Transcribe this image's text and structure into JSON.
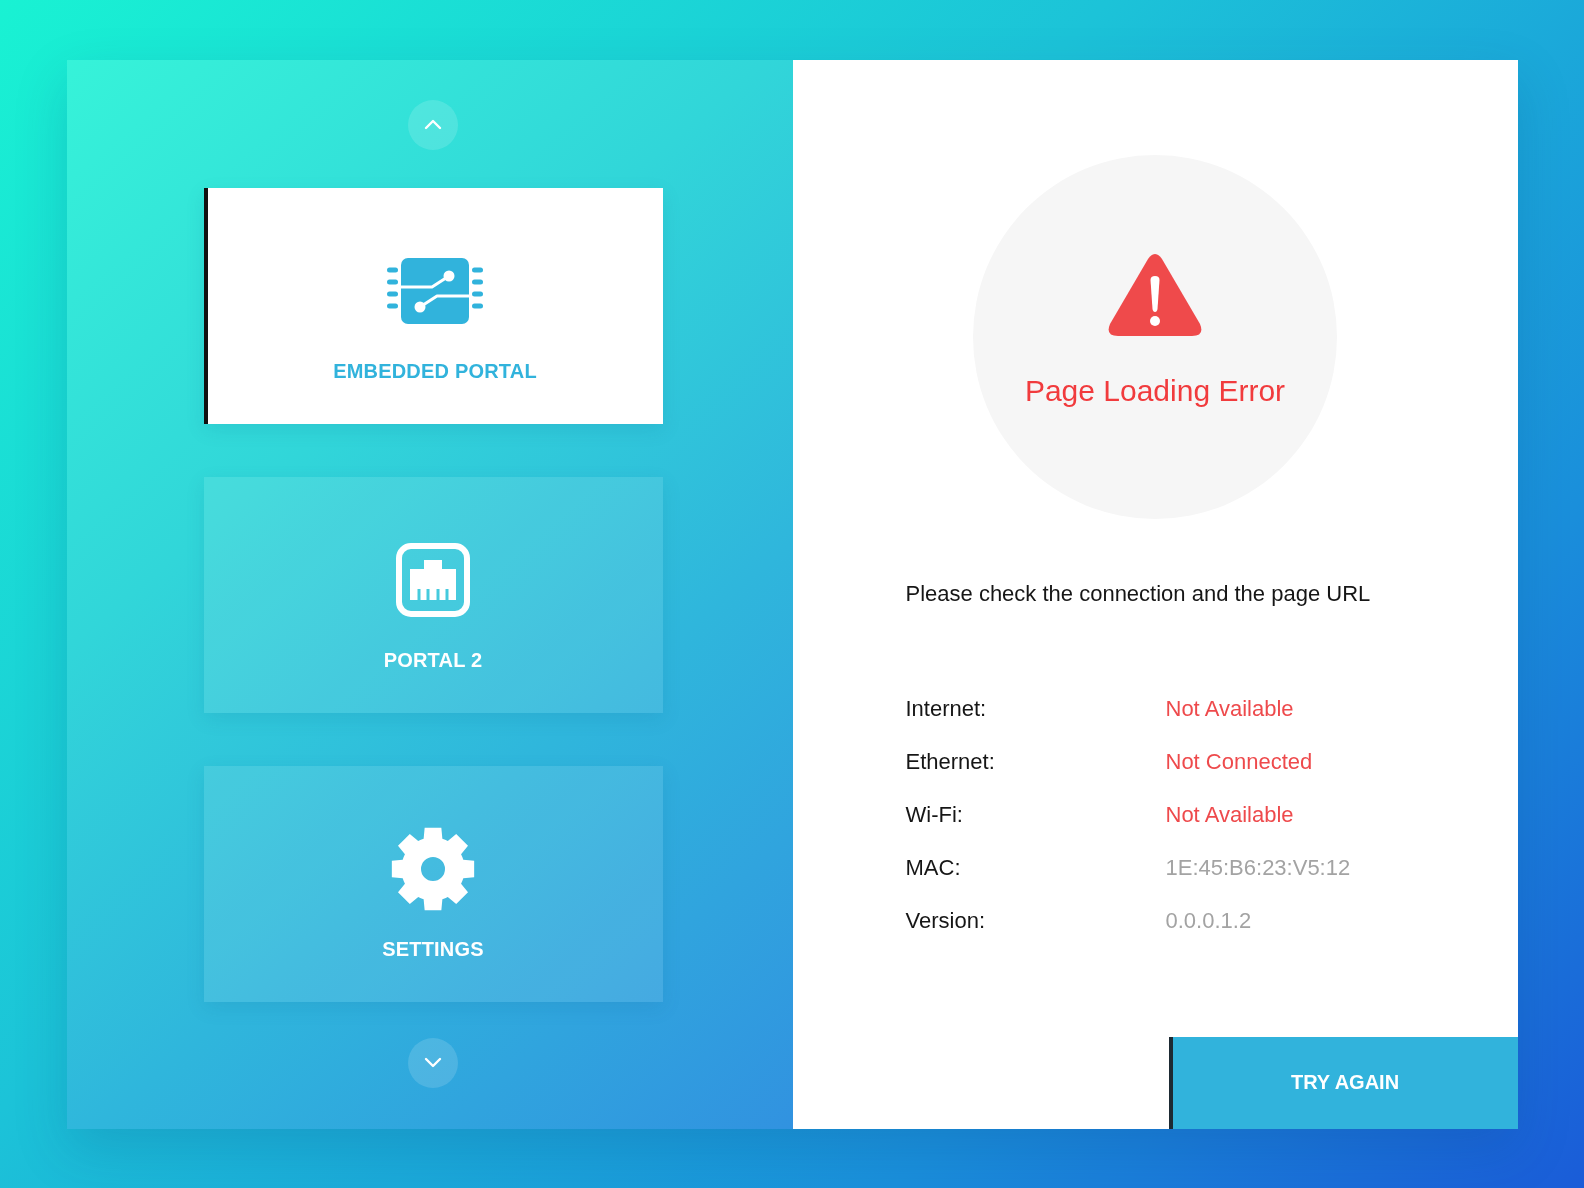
{
  "sidebar": {
    "items": [
      {
        "label": "EMBEDDED PORTAL",
        "kind": "chip",
        "selected": true
      },
      {
        "label": "PORTAL 2",
        "kind": "ethernet",
        "selected": false
      },
      {
        "label": "SETTINGS",
        "kind": "gear",
        "selected": false
      }
    ]
  },
  "error": {
    "title": "Page Loading Error",
    "message": "Please check the connection and the page URL"
  },
  "status": [
    {
      "label": "Internet:",
      "value": "Not Available",
      "alert": true
    },
    {
      "label": "Ethernet:",
      "value": "Not Connected",
      "alert": true
    },
    {
      "label": "Wi-Fi:",
      "value": "Not Available",
      "alert": true
    },
    {
      "label": "MAC:",
      "value": "1E:45:B6:23:V5:12",
      "alert": false
    },
    {
      "label": "Version:",
      "value": "0.0.0.1.2",
      "alert": false
    }
  ],
  "action": {
    "label": "TRY AGAIN"
  }
}
